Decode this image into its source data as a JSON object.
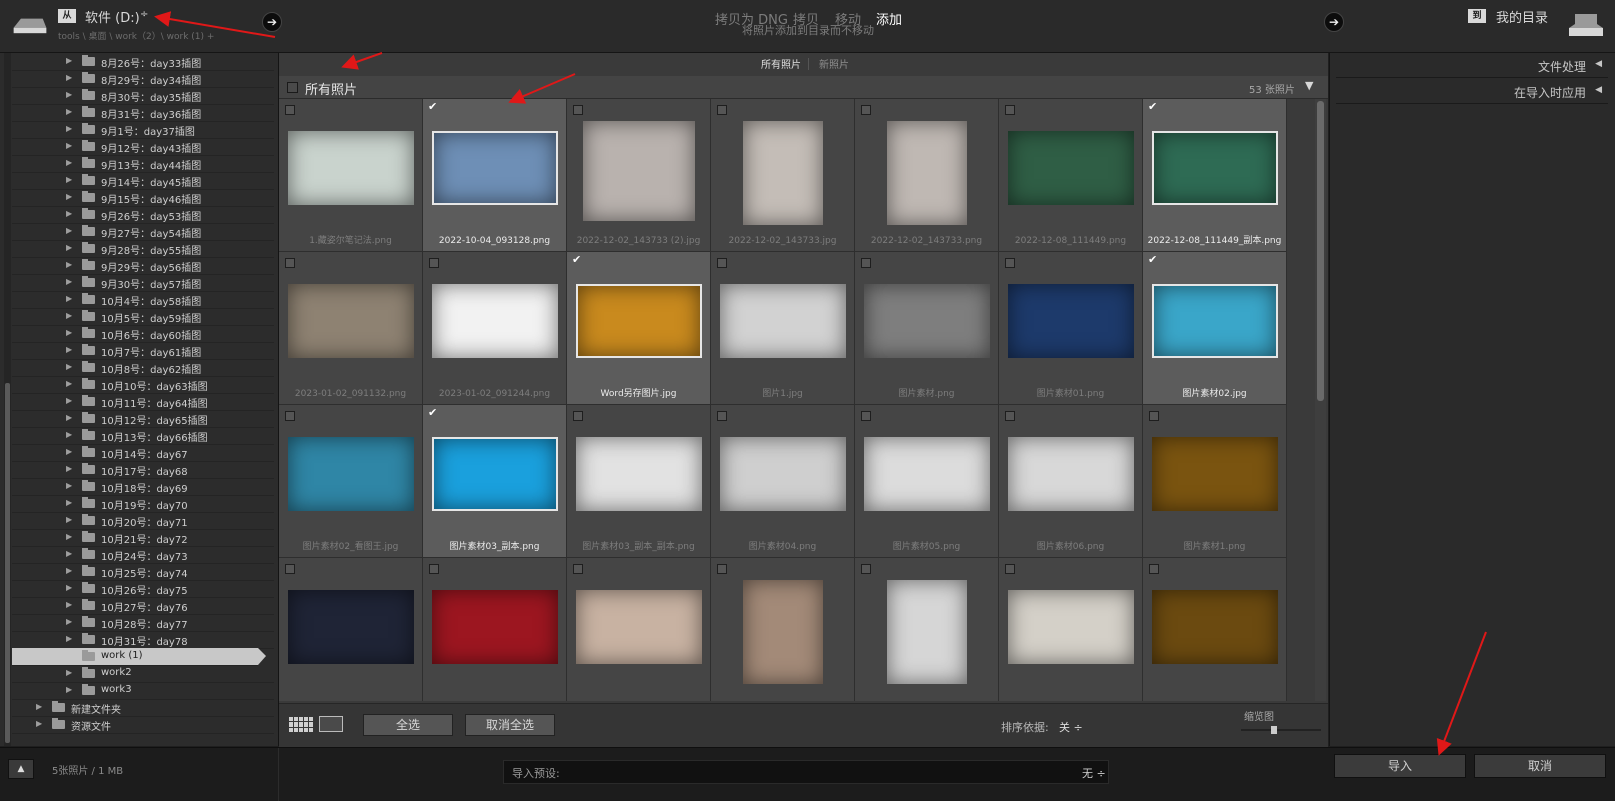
{
  "header": {
    "source_label": "软件 (D:)",
    "source_dropdown": "÷",
    "source_breadcrumb": "tools \\ 桌面 \\ work（2）\\ work (1) +",
    "modes": [
      "拷贝为 DNG",
      "拷贝",
      "移动",
      "添加"
    ],
    "active_mode_index": 3,
    "mode_description": "将照片添加到目录而不移动",
    "dest_label": "我的目录",
    "nav_arrow": "➔"
  },
  "folders": [
    "8月26号：day33插图",
    "8月29号：day34插图",
    "8月30号：day35插图",
    "8月31号：day36插图",
    "9月1号：day37插图",
    "9月12号：day43插图",
    "9月13号：day44插图",
    "9月14号：day45插图",
    "9月15号：day46插图",
    "9月26号：day53插图",
    "9月27号：day54插图",
    "9月28号：day55插图",
    "9月29号：day56插图",
    "9月30号：day57插图",
    "10月4号：day58插图",
    "10月5号：day59插图",
    "10月6号：day60插图",
    "10月7号：day61插图",
    "10月8号：day62插图",
    "10月10号：day63插图",
    "10月11号：day64插图",
    "10月12号：day65插图",
    "10月13号：day66插图",
    "10月14号：day67",
    "10月17号：day68",
    "10月18号：day69",
    "10月19号：day70",
    "10月20号：day71",
    "10月21号：day72",
    "10月24号：day73",
    "10月25号：day74",
    "10月26号：day75",
    "10月27号：day76",
    "10月28号：day77",
    "10月31号：day78"
  ],
  "folders_extra": [
    {
      "name": "work (1)",
      "selected": true
    },
    {
      "name": "work2",
      "selected": false
    },
    {
      "name": "work3",
      "selected": false
    },
    {
      "name": "新建文件夹",
      "selected": false
    },
    {
      "name": "资源文件",
      "selected": false
    }
  ],
  "grid": {
    "tabs": [
      "所有照片",
      "新照片"
    ],
    "section_title": "所有照片",
    "photo_count": "53 张照片",
    "collapse_icon": "▼",
    "check_mark": "✔",
    "cells": [
      {
        "name": "1.藏姿尔笔记法.png",
        "checked": false,
        "color": "#c9d3cd"
      },
      {
        "name": "2022-10-04_093128.png",
        "checked": true,
        "color": "#6e8fb6"
      },
      {
        "name": "2022-12-02_143733 (2).jpg",
        "checked": false,
        "color": "#b9b2ae"
      },
      {
        "name": "2022-12-02_143733.jpg",
        "checked": false,
        "color": "#c4bdb7"
      },
      {
        "name": "2022-12-02_143733.png",
        "checked": false,
        "color": "#bfb8b3"
      },
      {
        "name": "2022-12-08_111449.png",
        "checked": false,
        "color": "#2f5e45"
      },
      {
        "name": "2022-12-08_111449_副本.png",
        "checked": true,
        "color": "#2e6b54"
      },
      {
        "name": "2023-01-02_091132.png",
        "checked": false,
        "color": "#8e8272"
      },
      {
        "name": "2023-01-02_091244.png",
        "checked": false,
        "color": "#f2f2f2"
      },
      {
        "name": "Word另存图片.jpg",
        "checked": true,
        "color": "#c98a1e"
      },
      {
        "name": "图片1.jpg",
        "checked": false,
        "color": "#d2d2d2"
      },
      {
        "name": "图片素材.png",
        "checked": false,
        "color": "#7e7e7e"
      },
      {
        "name": "图片素材01.png",
        "checked": false,
        "color": "#1d3a6b"
      },
      {
        "name": "图片素材02.jpg",
        "checked": true,
        "color": "#3aa6c9"
      },
      {
        "name": "图片素材02_看图王.jpg",
        "checked": false,
        "color": "#2f86a6"
      },
      {
        "name": "图片素材03_副本.png",
        "checked": true,
        "color": "#1aa0dd"
      },
      {
        "name": "图片素材03_副本_副本.png",
        "checked": false,
        "color": "#e2e2e2"
      },
      {
        "name": "图片素材04.png",
        "checked": false,
        "color": "#cfcfcf"
      },
      {
        "name": "图片素材05.png",
        "checked": false,
        "color": "#dcdcdc"
      },
      {
        "name": "图片素材06.png",
        "checked": false,
        "color": "#d8d8d8"
      },
      {
        "name": "图片素材1.png",
        "checked": false,
        "color": "#7a5410"
      },
      {
        "name": "",
        "checked": false,
        "color": "#1f2436"
      },
      {
        "name": "",
        "checked": false,
        "color": "#9c1620"
      },
      {
        "name": "",
        "checked": false,
        "color": "#c8b2a2"
      },
      {
        "name": "",
        "checked": false,
        "color": "#a38a78"
      },
      {
        "name": "",
        "checked": false,
        "color": "#d6d6d6"
      },
      {
        "name": "",
        "checked": false,
        "color": "#d4d0c8"
      },
      {
        "name": "",
        "checked": false,
        "color": "#6b4a10"
      }
    ]
  },
  "toolbar": {
    "select_all": "全选",
    "deselect_all": "取消全选",
    "sort_label": "排序依据:",
    "sort_value": "关 ÷",
    "thumb_label": "缩览图"
  },
  "right_panel": {
    "sections": [
      "文件处理",
      "在导入时应用"
    ],
    "collapse_arrow": "◀"
  },
  "footer": {
    "summary": "5张照片 / 1 MB",
    "preset_label": "导入预设:",
    "preset_value": "无 ÷",
    "import": "导入",
    "cancel": "取消",
    "up_arrow": "▲"
  },
  "folder_arrow": "▶"
}
